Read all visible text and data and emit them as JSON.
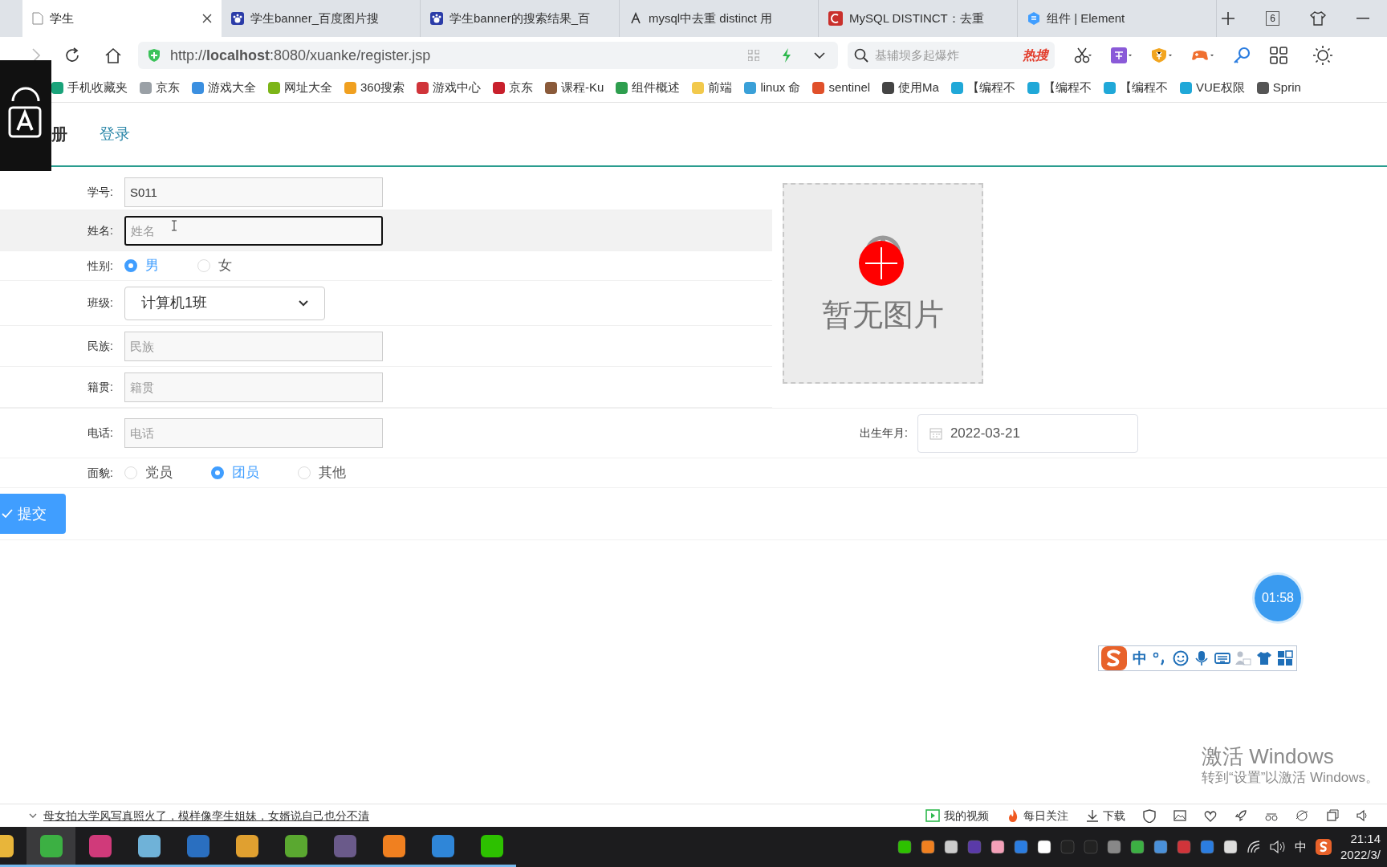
{
  "browser": {
    "tabs": [
      {
        "title": "学生",
        "selected": true,
        "kind": "page"
      },
      {
        "title": "学生banner_百度图片搜",
        "selected": false,
        "kind": "paw"
      },
      {
        "title": "学生banner的搜索结果_百",
        "selected": false,
        "kind": "paw"
      },
      {
        "title": "mysql中去重 distinct 用",
        "selected": false,
        "kind": "script"
      },
      {
        "title": "MySQL DISTINCT：去重",
        "selected": false,
        "kind": "letter"
      },
      {
        "title": "组件 | Element",
        "selected": false,
        "kind": "hex"
      }
    ],
    "tab_count": "6",
    "url": "http://**localhost**:8080/xuanke/register.jsp",
    "search": {
      "placeholder": "基辅坝多起爆炸",
      "badge": "热搜"
    },
    "bookmarks": [
      {
        "label": "手机收藏夹",
        "color": "#1aa37a"
      },
      {
        "label": "京东",
        "color": "#9aa0a6"
      },
      {
        "label": "游戏大全",
        "color": "#3b8fe0"
      },
      {
        "label": "网址大全",
        "color": "#7cb518"
      },
      {
        "label": "360搜索",
        "color": "#f0a020"
      },
      {
        "label": "游戏中心",
        "color": "#d0343a"
      },
      {
        "label": "京东",
        "color": "#c8202c"
      },
      {
        "label": "课程-Ku",
        "color": "#8a5a3a"
      },
      {
        "label": "组件概述",
        "color": "#2e9e4e"
      },
      {
        "label": "前端",
        "color": "#f2c94c"
      },
      {
        "label": "linux 命",
        "color": "#3aa0d8"
      },
      {
        "label": "sentinel",
        "color": "#e0502a"
      },
      {
        "label": "使用Ma",
        "color": "#444444"
      },
      {
        "label": "【编程不",
        "color": "#20a8d8"
      },
      {
        "label": "【编程不",
        "color": "#20a8d8"
      },
      {
        "label": "【编程不",
        "color": "#20a8d8"
      },
      {
        "label": "VUE权限",
        "color": "#20a8d8"
      },
      {
        "label": "Sprin",
        "color": "#555555"
      }
    ]
  },
  "page": {
    "header": {
      "title": "册",
      "link": "登录"
    },
    "fields": [
      {
        "kind": "text",
        "label": "学号:",
        "value": "S011",
        "focused": false,
        "highlighted": false
      },
      {
        "kind": "text",
        "label": "姓名:",
        "placeholder": "姓名",
        "focused": true,
        "highlighted": true
      },
      {
        "kind": "radio",
        "label": "性别:",
        "options": [
          {
            "label": "男",
            "selected": true
          },
          {
            "label": "女",
            "selected": false
          }
        ]
      },
      {
        "kind": "select",
        "label": "班级:",
        "value": "计算机1班"
      },
      {
        "kind": "text",
        "label": "民族:",
        "placeholder": "民族",
        "focused": false,
        "highlighted": false
      },
      {
        "kind": "text",
        "label": "籍贯:",
        "placeholder": "籍贯",
        "focused": false,
        "highlighted": false
      }
    ],
    "upload": {
      "text": "暂无图片"
    },
    "phone": {
      "label": "电话:",
      "placeholder": "电话"
    },
    "birth": {
      "label": "出生年月:",
      "value": "2022-03-21"
    },
    "politics": {
      "label": "面貌:",
      "options": [
        {
          "label": "党员",
          "selected": false
        },
        {
          "label": "团员",
          "selected": true
        },
        {
          "label": "其他",
          "selected": false
        }
      ]
    },
    "submit": "提交"
  },
  "timer": "01:58",
  "ime": {
    "mode": "中"
  },
  "windows_notice": {
    "title": "激活 Windows",
    "text": "转到“设置”以激活 Windows。"
  },
  "status_bar": {
    "news": "母女拍大学风写真照火了，模样像孪生姐妹，女婿说自己也分不清",
    "items": [
      {
        "label": "我的视频",
        "kind": "video"
      },
      {
        "label": "每日关注",
        "kind": "fire"
      },
      {
        "label": "下载",
        "kind": "download"
      }
    ]
  },
  "taskbar": {
    "apps": [
      {
        "color": "#e8b53a",
        "selected": false
      },
      {
        "color": "#3cb043",
        "selected": true
      },
      {
        "color": "#d03a7a",
        "selected": false
      },
      {
        "color": "#6fb2d8",
        "selected": false
      },
      {
        "color": "#2a6fc0",
        "selected": false
      },
      {
        "color": "#e0a030",
        "selected": false
      },
      {
        "color": "#5aa830",
        "selected": false
      },
      {
        "color": "#6a5a8a",
        "selected": false
      },
      {
        "color": "#f08020",
        "selected": false
      },
      {
        "color": "#2f86d8",
        "selected": false
      },
      {
        "color": "#2dc100",
        "selected": false
      }
    ],
    "tray_lang": "中",
    "time": "21:14",
    "date": "2022/3/"
  }
}
